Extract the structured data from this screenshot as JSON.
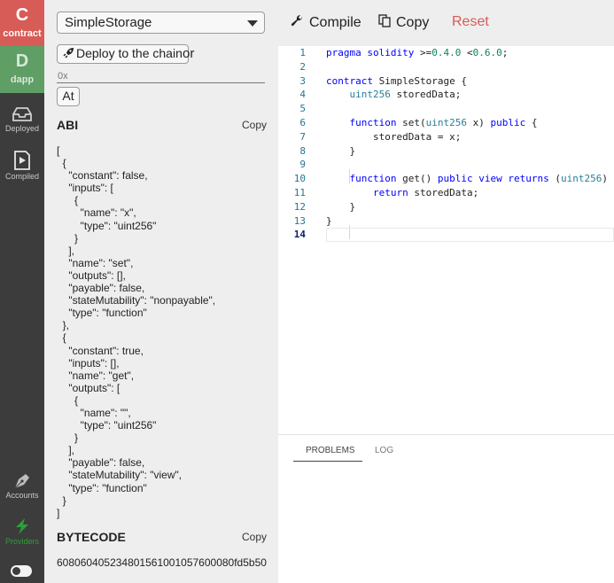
{
  "rail": {
    "contract": {
      "letter": "C",
      "label": "contract"
    },
    "dapp": {
      "letter": "D",
      "label": "dapp"
    },
    "nav": [
      {
        "label": "Deployed",
        "icon": "inbox-icon"
      },
      {
        "label": "Compiled",
        "icon": "play-file-icon"
      },
      {
        "label": "Accounts",
        "icon": "pen-nib-icon"
      },
      {
        "label": "Providers",
        "icon": "lightning-icon"
      }
    ]
  },
  "panel": {
    "contract_select": "SimpleStorage",
    "deploy_label": "Deploy to the chain",
    "or_text": "or",
    "address_placeholder": "0x",
    "at_label": "At",
    "abi_title": "ABI",
    "abi_copy": "Copy",
    "abi_lines": [
      "[",
      "  {",
      "    \"constant\": false,",
      "    \"inputs\": [",
      "      {",
      "        \"name\": \"x\",",
      "        \"type\": \"uint256\"",
      "      }",
      "    ],",
      "    \"name\": \"set\",",
      "    \"outputs\": [],",
      "    \"payable\": false,",
      "    \"stateMutability\": \"nonpayable\",",
      "    \"type\": \"function\"",
      "  },",
      "  {",
      "    \"constant\": true,",
      "    \"inputs\": [],",
      "    \"name\": \"get\",",
      "    \"outputs\": [",
      "      {",
      "        \"name\": \"\",",
      "        \"type\": \"uint256\"",
      "      }",
      "    ],",
      "    \"payable\": false,",
      "    \"stateMutability\": \"view\",",
      "    \"type\": \"function\"",
      "  }",
      "]"
    ],
    "bytecode_title": "BYTECODE",
    "bytecode_copy": "Copy",
    "bytecode_value": "608060405234801561001057600080fd5b50"
  },
  "toolbar": {
    "compile_label": "Compile",
    "copy_label": "Copy",
    "reset_label": "Reset"
  },
  "editor": {
    "active_line": 14,
    "line_numbers": [
      "1",
      "2",
      "3",
      "4",
      "5",
      "6",
      "7",
      "8",
      "9",
      "10",
      "11",
      "12",
      "13",
      "14"
    ]
  },
  "bottom_pane": {
    "tabs": [
      "PROBLEMS",
      "LOG"
    ]
  },
  "colors": {
    "contract_tile": "#d75b56",
    "dapp_tile": "#5f9e64",
    "rail": "#3c3c3c",
    "panel": "#eeeeee",
    "reset": "#d75b56",
    "keyword": "#0000ff",
    "type": "#267f99",
    "number": "#098658"
  }
}
